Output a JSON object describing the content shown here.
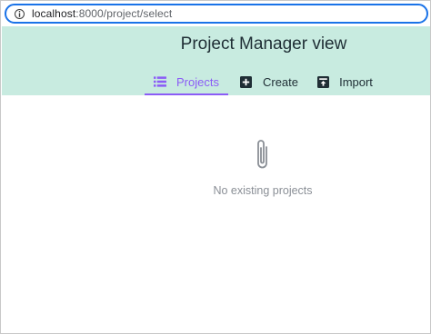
{
  "browser": {
    "url_host": "localhost",
    "url_path": ":8000/project/select"
  },
  "header": {
    "title": "Project Manager view"
  },
  "tabs": [
    {
      "label": "Projects",
      "icon": "list-icon",
      "active": true
    },
    {
      "label": "Create",
      "icon": "plus-square-icon",
      "active": false
    },
    {
      "label": "Import",
      "icon": "import-box-icon",
      "active": false
    }
  ],
  "empty_state": {
    "icon": "paperclip-icon",
    "message": "No existing projects"
  },
  "colors": {
    "header_bg": "#c8ebe0",
    "accent": "#8b5cf6",
    "address_bar_focus": "#1a73e8"
  }
}
